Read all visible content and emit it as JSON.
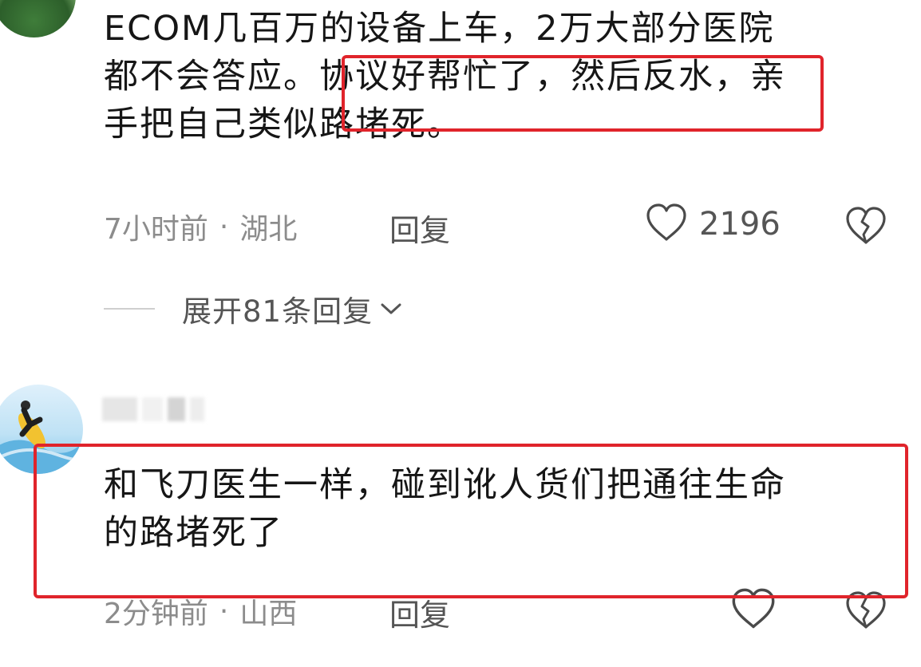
{
  "comments": [
    {
      "text": "ECOM几百万的设备上车，2万大部分医院\n都不会答应。协议好帮忙了，然后反水，亲\n手把自己类似路堵死。",
      "time": "7小时前",
      "separator": "·",
      "location": "湖北",
      "reply_label": "回复",
      "likes": "2196",
      "expand_replies_label": "展开81条回复"
    },
    {
      "text": "和飞刀医生一样，碰到讹人货们把通往生命\n的路堵死了",
      "time": "2分钟前",
      "separator": "·",
      "location": "山西",
      "reply_label": "回复"
    }
  ],
  "icons": {
    "like": "heart-outline-icon",
    "dislike": "broken-heart-icon",
    "expand": "chevron-down-icon"
  },
  "colors": {
    "highlight_border": "#e0242b",
    "text_primary": "#161616",
    "text_secondary": "#8c8c8c"
  }
}
